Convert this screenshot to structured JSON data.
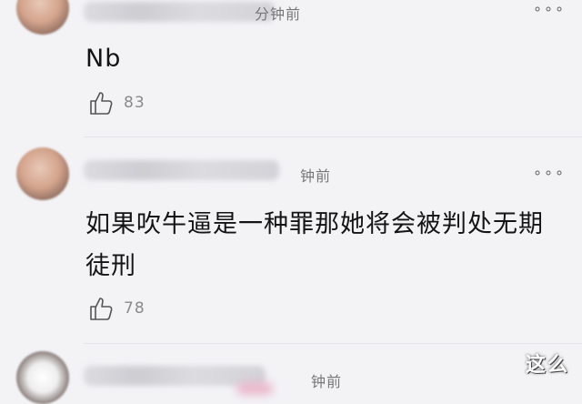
{
  "comments": [
    {
      "time": "分钟前",
      "text": "Nb",
      "likes": "83"
    },
    {
      "time": "钟前",
      "text": "如果吹牛逼是一种罪那她将会被判处无期徒刑",
      "likes": "78"
    },
    {
      "time": "钟前"
    }
  ],
  "more_label": "∘∘∘",
  "watermark": "这么"
}
